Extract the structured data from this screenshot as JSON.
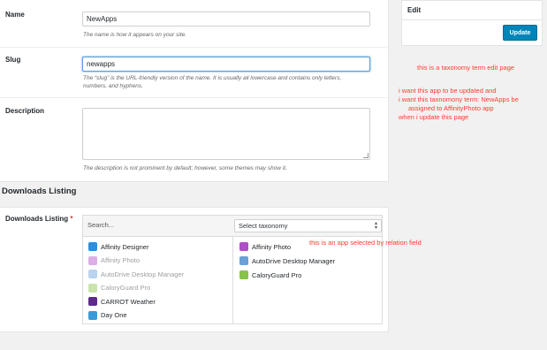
{
  "form": {
    "name_label": "Name",
    "name_value": "NewApps",
    "name_help": "The name is how it appears on your site.",
    "slug_label": "Slug",
    "slug_value": "newapps",
    "slug_help_line1": "The “slug” is the URL-friendly version of the name. It is usually all lowercase and contains only letters,",
    "slug_help_line2": "numbers, and hyphens.",
    "desc_label": "Description",
    "desc_value": "",
    "desc_help": "The description is not prominent by default; however, some themes may show it."
  },
  "edit_box": {
    "title": "Edit",
    "update_label": "Update"
  },
  "downloads": {
    "section_title": "Downloads Listing",
    "field_label": "Downloads Listing",
    "required_mark": "*",
    "search_placeholder": "Search...",
    "taxonomy_select": "Select taxonomy",
    "left_items": [
      {
        "label": "Affinity Designer",
        "icon": "affinity-designer-icon",
        "color": "#2a8fe0",
        "faded": false
      },
      {
        "label": "Affinity Photo",
        "icon": "affinity-photo-icon",
        "color": "#b04fc8",
        "faded": true
      },
      {
        "label": "AutoDrive Desktop Manager",
        "icon": "autodrive-icon",
        "color": "#6aa0d8",
        "faded": true
      },
      {
        "label": "CaloryGuard Pro",
        "icon": "caloryguard-icon",
        "color": "#88c24a",
        "faded": true
      },
      {
        "label": "CARROT Weather",
        "icon": "carrot-weather-icon",
        "color": "#5e2a8a",
        "faded": false
      },
      {
        "label": "Day One",
        "icon": "day-one-icon",
        "color": "#3a9ad9",
        "faded": false
      }
    ],
    "right_items": [
      {
        "label": "Affinity Photo",
        "icon": "affinity-photo-icon",
        "color": "#b04fc8"
      },
      {
        "label": "AutoDrive Desktop Manager",
        "icon": "autodrive-icon",
        "color": "#6aa0d8"
      },
      {
        "label": "CaloryGuard Pro",
        "icon": "caloryguard-icon",
        "color": "#88c24a"
      }
    ]
  },
  "annotations": {
    "note1": "this is a taxonomy term edit page",
    "note2_line1": "i want this app to be updated and",
    "note2_line2": "i want this taxnomony term: NewApps be",
    "note2_line3": "assigned to AffinityPhoto app",
    "note2_line4": "when i update this page",
    "note3": "this is an app selected by relation field"
  },
  "colors": {
    "accent": "#0085ba",
    "note": "#ff3b30"
  }
}
